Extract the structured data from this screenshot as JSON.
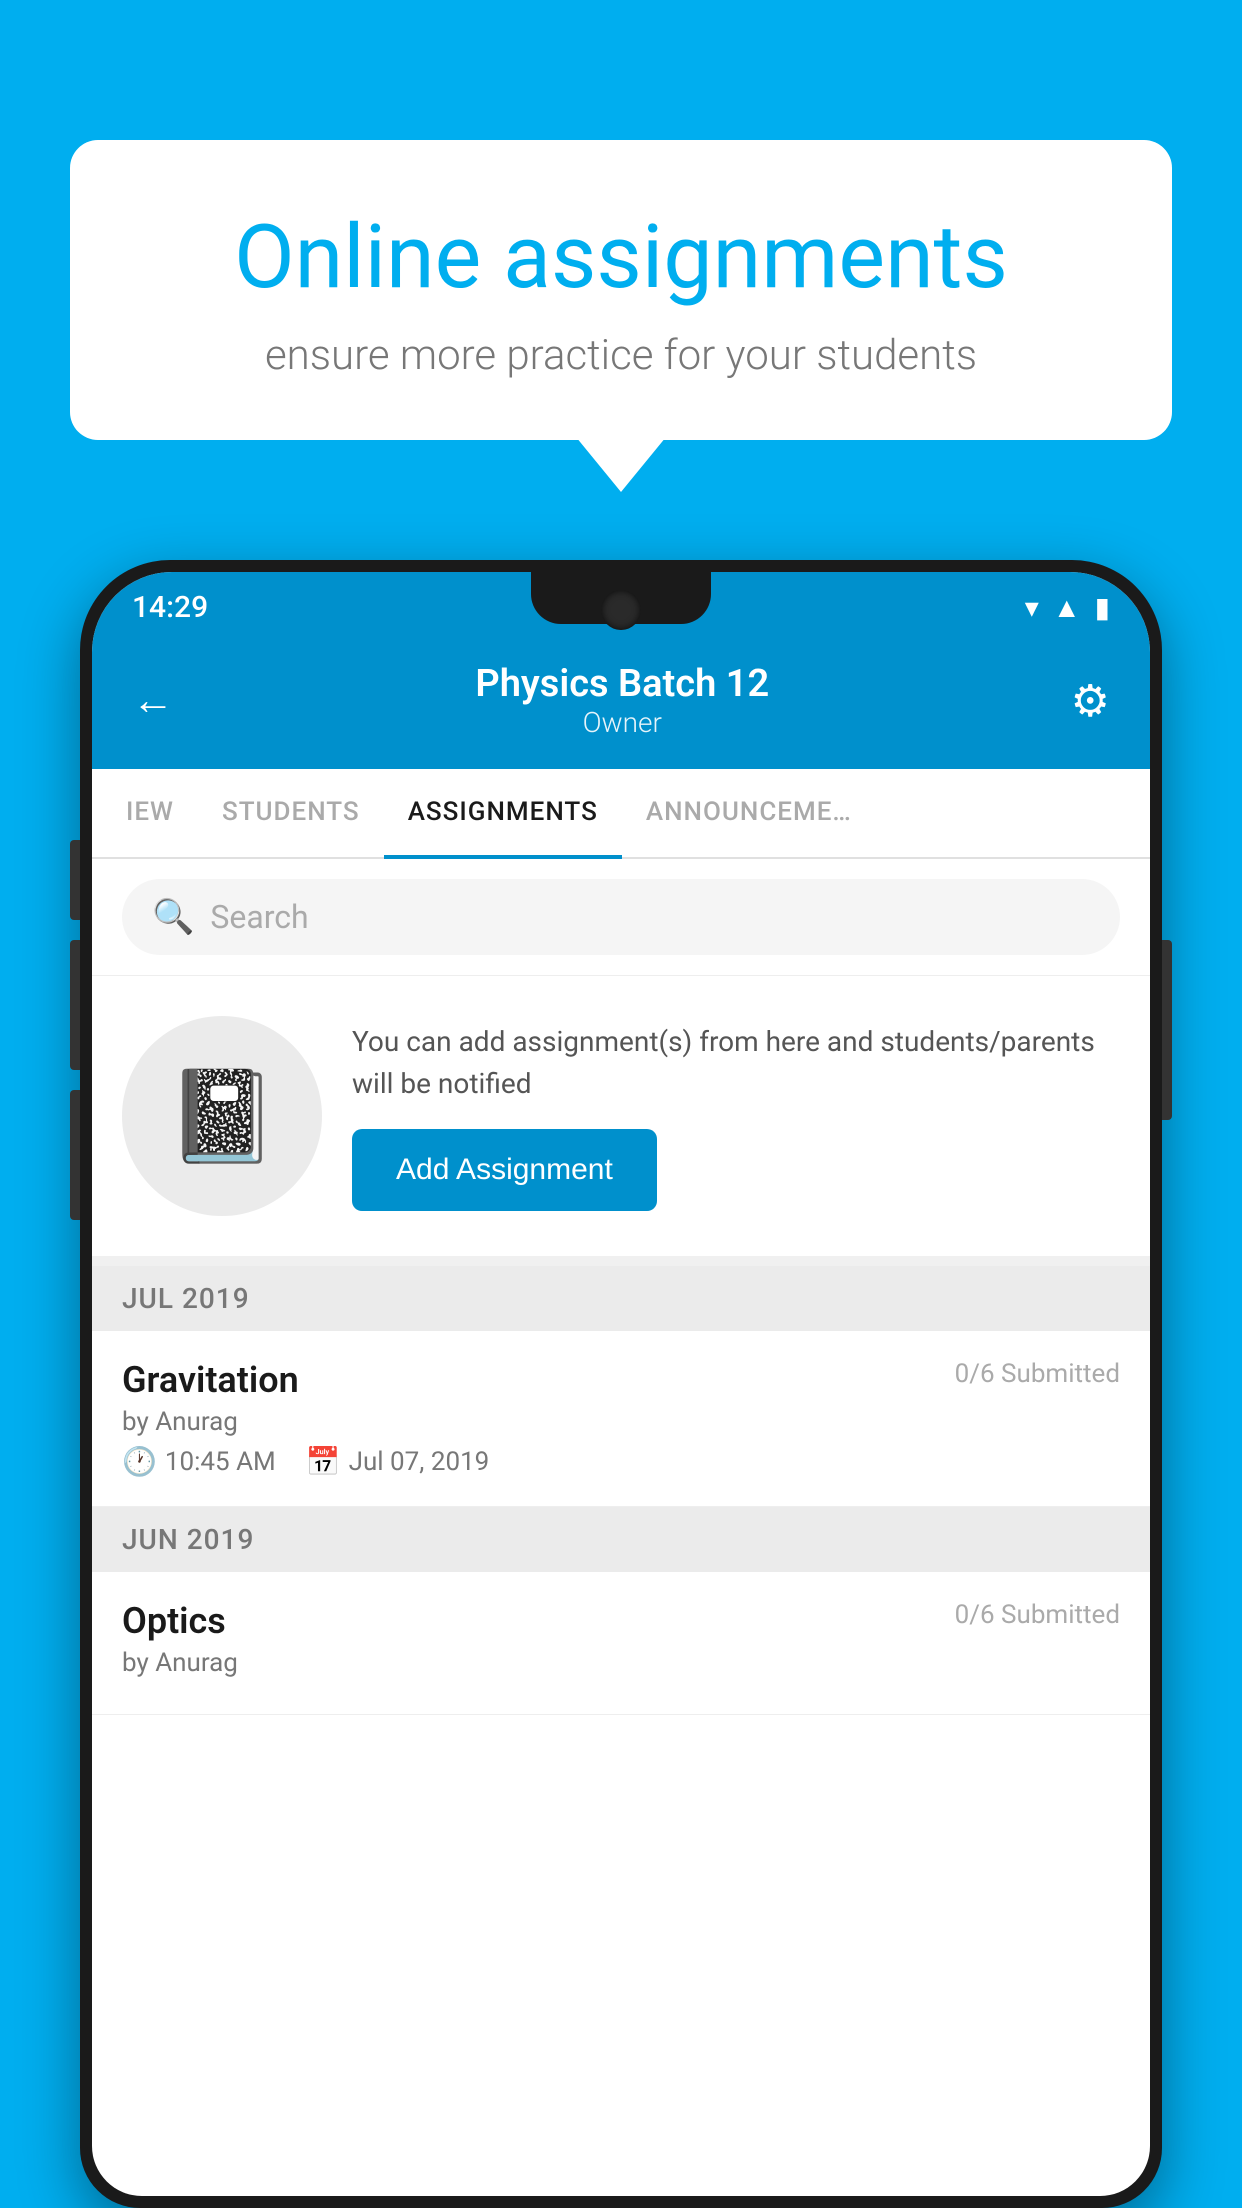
{
  "background_color": "#00AEEF",
  "speech_bubble": {
    "title": "Online assignments",
    "subtitle": "ensure more practice for your students"
  },
  "phone": {
    "status_bar": {
      "time": "14:29"
    },
    "header": {
      "title": "Physics Batch 12",
      "subtitle": "Owner",
      "back_label": "←",
      "settings_label": "⚙"
    },
    "tabs": [
      {
        "label": "IEW",
        "active": false
      },
      {
        "label": "STUDENTS",
        "active": false
      },
      {
        "label": "ASSIGNMENTS",
        "active": true
      },
      {
        "label": "ANNOUNCEMENTS",
        "active": false
      }
    ],
    "search": {
      "placeholder": "Search"
    },
    "promo": {
      "text": "You can add assignment(s) from here and students/parents will be notified",
      "button_label": "Add Assignment"
    },
    "sections": [
      {
        "month": "JUL 2019",
        "assignments": [
          {
            "name": "Gravitation",
            "submitted": "0/6 Submitted",
            "by": "by Anurag",
            "time": "10:45 AM",
            "date": "Jul 07, 2019"
          }
        ]
      },
      {
        "month": "JUN 2019",
        "assignments": [
          {
            "name": "Optics",
            "submitted": "0/6 Submitted",
            "by": "by Anurag",
            "time": "",
            "date": ""
          }
        ]
      }
    ]
  }
}
